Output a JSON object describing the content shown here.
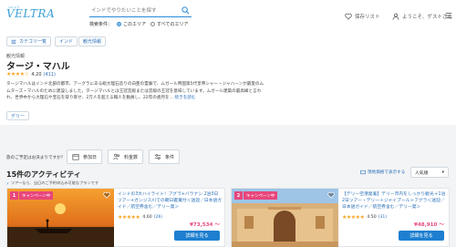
{
  "header": {
    "logo_text": "VELTRA",
    "logo_sub": "ベルトラ",
    "search_placeholder": "インドでやりたいことを探す",
    "search_condition_label": "検索条件：",
    "search_option_area": "このエリア",
    "search_option_all": "すべてのエリア",
    "saved_list": "保存リスト",
    "welcome": "ようこそ、ゲストさん"
  },
  "tags": [
    {
      "label": "カテゴリ一覧"
    },
    {
      "label": "インド"
    },
    {
      "label": "観光情報"
    }
  ],
  "breadcrumb": "観光情報",
  "title": "タージ・マハル",
  "rating": {
    "score": "4.20",
    "count": "(411)",
    "stars": "★★★★☆"
  },
  "description": "タージマハルはインド北部の都市、アーグラにある総大理石造りの白亜の霊廟で、ムガール帝国第5代皇帝シャー・ジャハーンが最愛のムムターズ・マハルのために建設しました。タージマハルとは王冠宮殿または宮殿の王冠を意味しています。ムガール建築の最高峰と言われ、世界中から大理石や宝石を取り寄せ、2万人を超える職人を動員し、22年の歳月を...",
  "desc_more": "続きを読む",
  "chip": "デリー",
  "filters": {
    "question": "旅のご予定はお決まりですか？",
    "date": "参加日",
    "price": "料金数",
    "condition": "条件"
  },
  "list": {
    "count_title": "15件のアクティビティ",
    "note": "ツアーなら、当日のご予約申込み可能なプランです",
    "map_link": "現地価格で表示する",
    "sort": "人気順"
  },
  "cards": [
    {
      "rank": "1",
      "badge": "キャンペーン中",
      "title": "インドの3大ハイライト！アグラ+バラナシ 2泊3日ツアー+ガンジス川での朝日鑑賞付＜送迎／日本語ガイド／航空券含む／デリー発＞",
      "score": "4.60",
      "count": "(26)",
      "price": "¥73,534 〜",
      "button": "詳細を見る"
    },
    {
      "rank": "2",
      "badge": "キャンペーン中",
      "title": "【デリー空港発着】デリー市内をしっかり観光＋1泊2日ツアー・デリー＋ジャイプール＋アグラ＜送迎／日本語ガイド／航空券含む／デリー発＞",
      "score": "4.50",
      "count": "(31)",
      "price": "¥48,910 〜",
      "button": "詳細を見る"
    }
  ],
  "colors": {
    "accent": "#2a8ad8",
    "pink": "#e8467c",
    "star": "#f5a623"
  }
}
